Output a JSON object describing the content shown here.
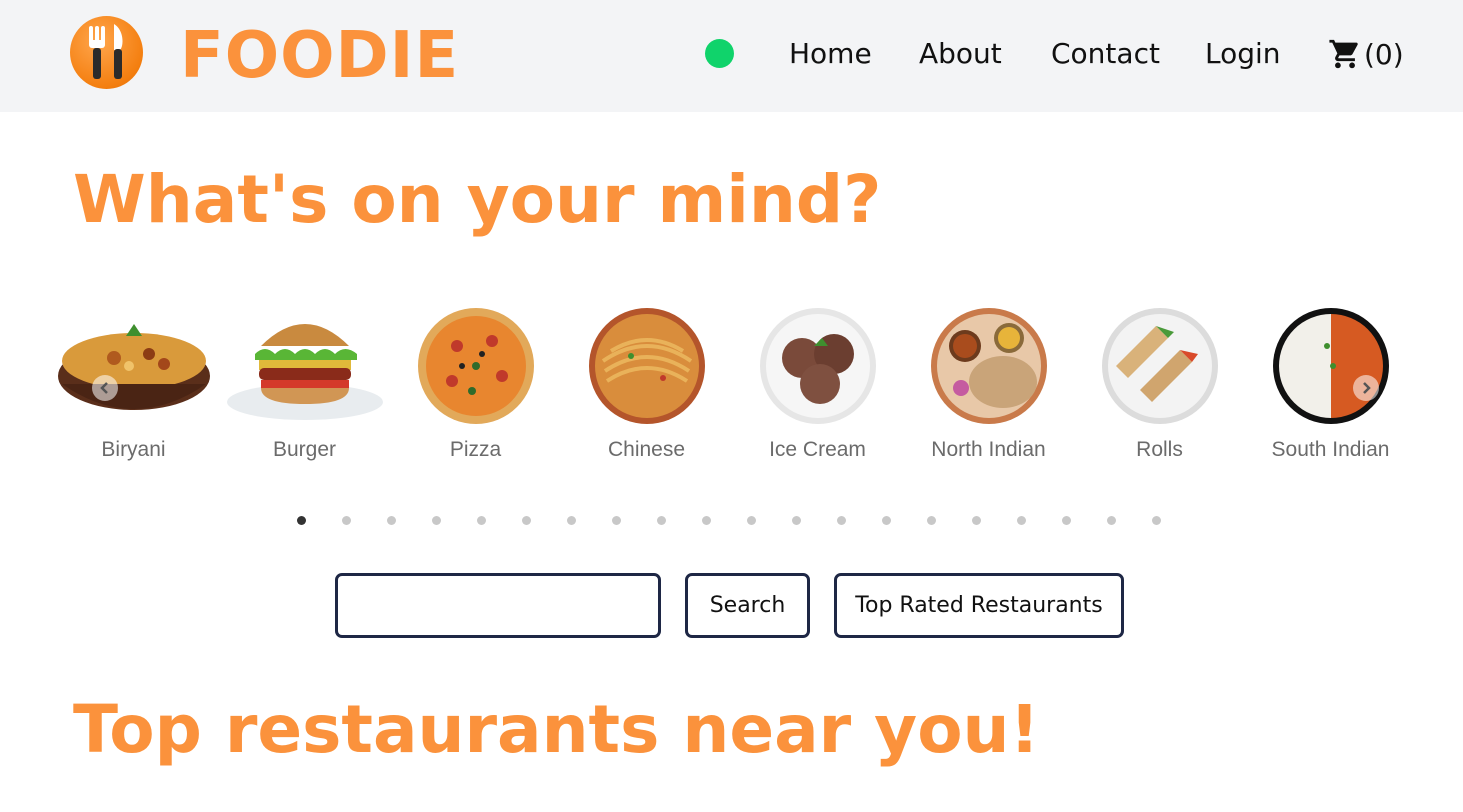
{
  "header": {
    "brand": "FOODIE",
    "logo_icon": "fork-knife-icon",
    "accent_color": "#fb923c",
    "status_color": "#10d36b",
    "nav": {
      "home": "Home",
      "about": "About",
      "contact": "Contact",
      "login": "Login"
    },
    "cart": {
      "icon": "cart-icon",
      "count_label": "(0)"
    }
  },
  "section_mind": {
    "title": "What's on your mind?"
  },
  "carousel": {
    "items": [
      {
        "label": "Biryani",
        "icon": "biryani-image"
      },
      {
        "label": "Burger",
        "icon": "burger-image"
      },
      {
        "label": "Pizza",
        "icon": "pizza-image"
      },
      {
        "label": "Chinese",
        "icon": "noodles-image"
      },
      {
        "label": "Ice Cream",
        "icon": "ice-cream-image"
      },
      {
        "label": "North Indian",
        "icon": "thali-image"
      },
      {
        "label": "Rolls",
        "icon": "rolls-image"
      },
      {
        "label": "South Indian",
        "icon": "rice-curry-image"
      }
    ],
    "dot_count": 20,
    "active_dot": 1
  },
  "search": {
    "value": "",
    "placeholder": "",
    "search_label": "Search",
    "top_rated_label": "Top Rated Restaurants"
  },
  "section_restaurants": {
    "title": "Top restaurants near you!"
  }
}
